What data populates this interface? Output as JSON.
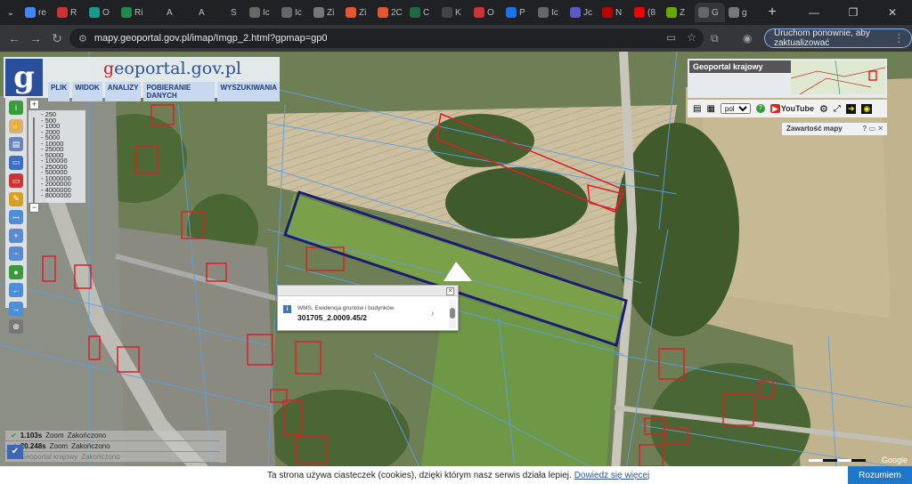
{
  "browser": {
    "tabs": [
      {
        "icon": "google-icon",
        "label": "re",
        "color": "#4285f4"
      },
      {
        "icon": "g-red-icon",
        "label": "R",
        "color": "#c33"
      },
      {
        "icon": "o-icon",
        "label": "O",
        "color": "#1a9b8b"
      },
      {
        "icon": "r-green-icon",
        "label": "Ri",
        "color": "#1f8a4c"
      },
      {
        "icon": "a-icon",
        "label": "A",
        "color": "#222"
      },
      {
        "icon": "a-icon",
        "label": "A",
        "color": "#222"
      },
      {
        "icon": "a-icon",
        "label": "S",
        "color": "#222"
      },
      {
        "icon": "globe-icon",
        "label": "Ic",
        "color": "#666"
      },
      {
        "icon": "globe-icon",
        "label": "Ic",
        "color": "#666"
      },
      {
        "icon": "z-icon",
        "label": "Zi",
        "color": "#777"
      },
      {
        "icon": "house-icon",
        "label": "Zi",
        "color": "#e4572e"
      },
      {
        "icon": "house-icon",
        "label": "2C",
        "color": "#e4572e"
      },
      {
        "icon": "c-icon",
        "label": "C",
        "color": "#1c6b3c"
      },
      {
        "icon": "k-icon",
        "label": "K",
        "color": "#444"
      },
      {
        "icon": "gmail-icon",
        "label": "O",
        "color": "#c33"
      },
      {
        "icon": "p-icon",
        "label": "P",
        "color": "#1a73e8"
      },
      {
        "icon": "globe-icon",
        "label": "Ic",
        "color": "#666"
      },
      {
        "icon": "j-icon",
        "label": "Jc",
        "color": "#5a5ac8"
      },
      {
        "icon": "netflix-icon",
        "label": "N",
        "color": "#b00"
      },
      {
        "icon": "youtube-icon",
        "label": "(8",
        "color": "#e00"
      },
      {
        "icon": "z-icon",
        "label": "Z",
        "color": "#6a0"
      },
      {
        "icon": "globe-icon",
        "label": "G",
        "color": "#666"
      },
      {
        "icon": "g-icon",
        "label": "g",
        "color": "#777"
      }
    ],
    "url": "mapy.geoportal.gov.pl/imap/Imgp_2.html?gpmap=gp0",
    "update_label": "Uruchom ponownie, aby zaktualizować"
  },
  "logo": {
    "letter": "g",
    "name_prefix": "g",
    "name_rest": "eoportal.gov.pl"
  },
  "menu": [
    "PLIK",
    "WIDOK",
    "ANALIZY",
    "POBIERANIE DANYCH",
    "WYSZUKIWANIA"
  ],
  "scale_levels": [
    "250",
    "500",
    "1000",
    "2000",
    "5000",
    "10000",
    "25000",
    "50000",
    "100000",
    "250000",
    "500000",
    "1000000",
    "2000000",
    "4000000",
    "8000000"
  ],
  "top_right": {
    "title": "Geoportal krajowy",
    "lang": "pol",
    "youtube": "YouTube",
    "content_title": "Zawartość mapy"
  },
  "popup": {
    "layer": "WMS, Ewidencja gruntów i budynków",
    "parcel": "301705_2.0009.45/2"
  },
  "status": [
    {
      "value": "1.103s",
      "label": "Zoom",
      "state": "Zakończono"
    },
    {
      "value": "20.248s",
      "label": "Zoom",
      "state": "Zakończono"
    },
    {
      "value": "",
      "label": "Geoportal krajowy",
      "state": "Zakończono"
    }
  ],
  "cookie": {
    "text": "Ta strona używa ciasteczek (cookies), dzięki którym nasz serwis działa lepiej.",
    "link": "Dowiedz się więcej",
    "button": "Rozumiem"
  },
  "map_attribution": "Google"
}
